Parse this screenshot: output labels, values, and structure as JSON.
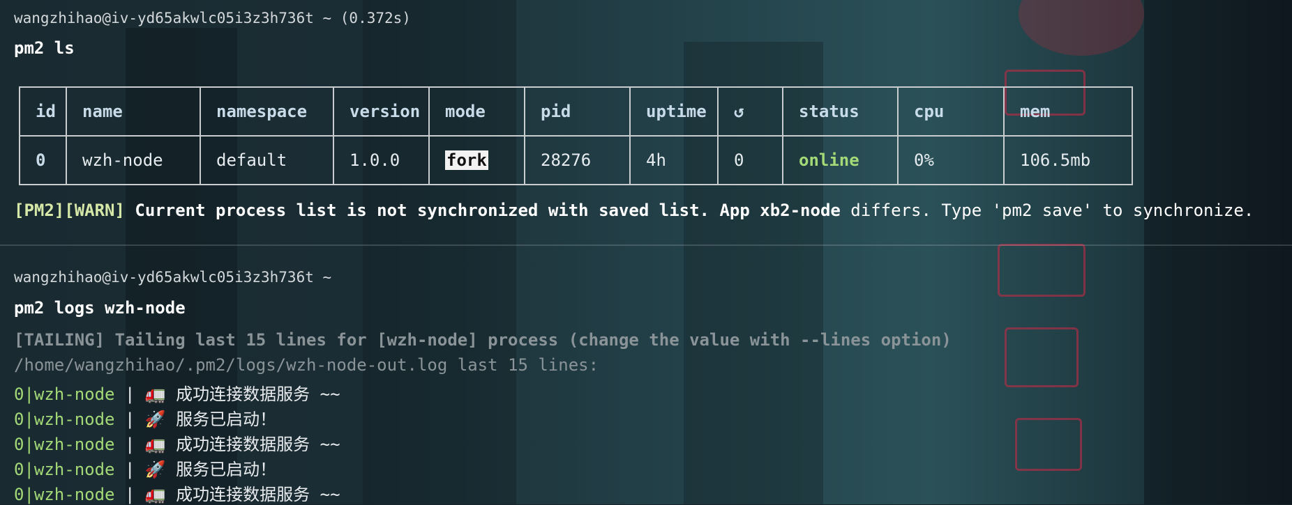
{
  "block1": {
    "prompt": "wangzhihao@iv-yd65akwlc05i3z3h736t ~ (0.372s)",
    "command": "pm2 ls"
  },
  "table": {
    "headers": [
      "id",
      "name",
      "namespace",
      "version",
      "mode",
      "pid",
      "uptime",
      "↺",
      "status",
      "cpu",
      "mem"
    ],
    "row": {
      "id": "0",
      "name": "wzh-node",
      "namespace": "default",
      "version": "1.0.0",
      "mode": "fork",
      "pid": "28276",
      "uptime": "4h",
      "restarts": "0",
      "status": "online",
      "cpu": "0%",
      "mem": "106.5mb"
    }
  },
  "warning": {
    "tag": "[PM2][WARN]",
    "bold_text": " Current process list is not synchronized with saved list. App xb2-node",
    "rest": " differs. Type 'pm2 save' to synchronize."
  },
  "block2": {
    "prompt": "wangzhihao@iv-yd65akwlc05i3z3h736t ~",
    "command": "pm2 logs wzh-node",
    "tailing": "[TAILING] Tailing last 15 lines for [wzh-node] process (change the value with --lines option)",
    "logfile": "/home/wangzhihao/.pm2/logs/wzh-node-out.log last 15 lines:",
    "log_lines": [
      {
        "prefix": "0|wzh-node",
        "text": " | 🚛 成功连接数据服务 ~~"
      },
      {
        "prefix": "0|wzh-node",
        "text": " | 🚀 服务已启动！"
      },
      {
        "prefix": "0|wzh-node",
        "text": " | 🚛 成功连接数据服务 ~~"
      },
      {
        "prefix": "0|wzh-node",
        "text": " | 🚀 服务已启动！"
      },
      {
        "prefix": "0|wzh-node",
        "text": " | 🚛 成功连接数据服务 ~~"
      }
    ]
  },
  "colors": {
    "background": "#17242b",
    "green": "#a3d977",
    "header_text": "#c8dbe8",
    "dim_text": "#8a9498"
  }
}
